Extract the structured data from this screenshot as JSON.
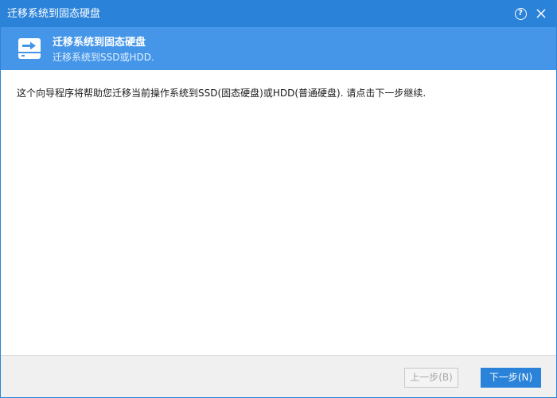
{
  "window": {
    "title": "迁移系统到固态硬盘",
    "help_glyph": "?",
    "close_glyph": "✕",
    "accent_color": "#2b83d9"
  },
  "banner": {
    "icon": "drive-arrow-icon",
    "title": "迁移系统到固态硬盘",
    "subtitle": "迁移系统到SSD或HDD."
  },
  "content": {
    "description": "这个向导程序将帮助您迁移当前操作系统到SSD(固态硬盘)或HDD(普通硬盘). 请点击下一步继续."
  },
  "footer": {
    "prev_label": "上一步(B)",
    "next_label": "下一步(N)"
  }
}
